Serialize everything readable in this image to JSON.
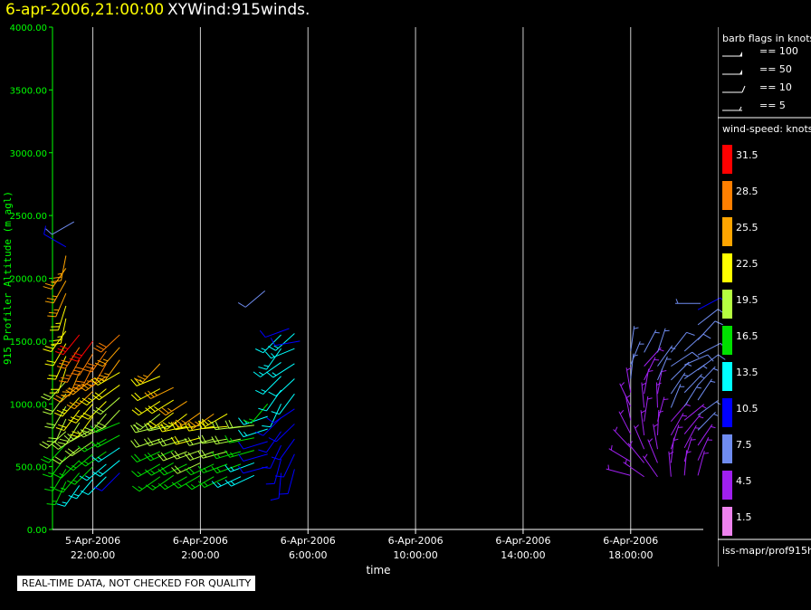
{
  "header": {
    "date_time": "6-apr-2006,21:00:00",
    "product": "XYWind:915winds."
  },
  "legend": {
    "barb_title": "barb flags in knots",
    "barbs": [
      {
        "label": "== 100",
        "type": "flag"
      },
      {
        "label": "== 50",
        "type": "flag"
      },
      {
        "label": "== 10",
        "type": "full"
      },
      {
        "label": "== 5",
        "type": "half"
      }
    ],
    "speed_title": "wind-speed: knots",
    "speed_bins": [
      {
        "label": "31.5",
        "color": "#ff0000"
      },
      {
        "label": "28.5",
        "color": "#ff7f00"
      },
      {
        "label": "25.5",
        "color": "#ffa500"
      },
      {
        "label": "22.5",
        "color": "#ffff00"
      },
      {
        "label": "19.5",
        "color": "#b5ff40"
      },
      {
        "label": "16.5",
        "color": "#00e000"
      },
      {
        "label": "13.5",
        "color": "#00ffff"
      },
      {
        "label": "10.5",
        "color": "#0000ff"
      },
      {
        "label": "7.5",
        "color": "#6f8cf0"
      },
      {
        "label": "4.5",
        "color": "#a020f0"
      },
      {
        "label": "1.5",
        "color": "#ee82ee"
      }
    ],
    "source": "iss-mapr/prof915h"
  },
  "footer_note": "REAL-TIME DATA, NOT CHECKED FOR QUALITY",
  "colors": {
    "axis": "#00ff00",
    "grid": "#cccccc",
    "background": "#000000",
    "title_date": "#ffff00"
  },
  "chart_data": {
    "type": "scatter",
    "marker": "wind-barb",
    "xlabel": "time",
    "ylabel": "915 Profiler Altitude (m agl)",
    "ylim": [
      0,
      4000
    ],
    "yticks": [
      "0.00",
      "500.00",
      "1000.00",
      "1500.00",
      "2000.00",
      "2500.00",
      "3000.00",
      "3500.00",
      "4000.00"
    ],
    "xlim_hours": [
      20.5,
      44.7
    ],
    "xticks": [
      {
        "date": "5-Apr-2006",
        "time": "22:00:00"
      },
      {
        "date": "6-Apr-2006",
        "time": "2:00:00"
      },
      {
        "date": "6-Apr-2006",
        "time": "6:00:00"
      },
      {
        "date": "6-Apr-2006",
        "time": "10:00:00"
      },
      {
        "date": "6-Apr-2006",
        "time": "14:00:00"
      },
      {
        "date": "6-Apr-2006",
        "time": "18:00:00"
      }
    ],
    "xtick_hours": [
      22,
      26,
      30,
      34,
      38,
      42
    ],
    "grid": "vertical",
    "legend_position": "right",
    "speed_units": "knots",
    "profiles": [
      {
        "time": "5-Apr-2006 21:00",
        "hour": 21.0,
        "alt_start": 380,
        "alt_step": 100,
        "alt_count": 19,
        "dir_start": 220,
        "dir_end": 200,
        "speed_start": 16,
        "speed_end": 26
      },
      {
        "time": "5-Apr-2006 21:30",
        "hour": 21.5,
        "alt_start": 350,
        "alt_step": 100,
        "alt_count": 13,
        "dir_start": 230,
        "dir_end": 210,
        "speed_start": 14,
        "speed_end": 30
      },
      {
        "time": "5-Apr-2006 22:00",
        "hour": 22.0,
        "alt_start": 400,
        "alt_step": 100,
        "alt_count": 12,
        "dir_start": 235,
        "dir_end": 215,
        "speed_start": 14,
        "speed_end": 31
      },
      {
        "time": "5-Apr-2006 22:30",
        "hour": 22.5,
        "alt_start": 420,
        "alt_step": 100,
        "alt_count": 11,
        "dir_start": 240,
        "dir_end": 220,
        "speed_start": 12,
        "speed_end": 29
      },
      {
        "time": "5-Apr-2006 23:00",
        "hour": 23.0,
        "alt_start": 450,
        "alt_step": 100,
        "alt_count": 12,
        "dir_start": 240,
        "dir_end": 225,
        "speed_start": 11,
        "speed_end": 28
      },
      {
        "time": "6-Apr-2006 00:30",
        "hour": 24.5,
        "alt_start": 420,
        "alt_step": 100,
        "alt_count": 10,
        "dir_start": 250,
        "dir_end": 235,
        "speed_start": 16,
        "speed_end": 24
      },
      {
        "time": "6-Apr-2006 01:00",
        "hour": 25.0,
        "alt_start": 430,
        "alt_step": 100,
        "alt_count": 8,
        "dir_start": 250,
        "dir_end": 240,
        "speed_start": 15,
        "speed_end": 24
      },
      {
        "time": "6-Apr-2006 01:30",
        "hour": 25.5,
        "alt_start": 420,
        "alt_step": 100,
        "alt_count": 7,
        "dir_start": 255,
        "dir_end": 240,
        "speed_start": 16,
        "speed_end": 25
      },
      {
        "time": "6-Apr-2006 02:00",
        "hour": 26.0,
        "alt_start": 430,
        "alt_step": 100,
        "alt_count": 6,
        "dir_start": 255,
        "dir_end": 245,
        "speed_start": 17,
        "speed_end": 25
      },
      {
        "time": "6-Apr-2006 02:30",
        "hour": 26.5,
        "alt_start": 420,
        "alt_step": 100,
        "alt_count": 6,
        "dir_start": 255,
        "dir_end": 245,
        "speed_start": 16,
        "speed_end": 24
      },
      {
        "time": "6-Apr-2006 03:00",
        "hour": 27.0,
        "alt_start": 420,
        "alt_step": 100,
        "alt_count": 6,
        "dir_start": 260,
        "dir_end": 250,
        "speed_start": 15,
        "speed_end": 23
      },
      {
        "time": "6-Apr-2006 03:30",
        "hour": 27.5,
        "alt_start": 420,
        "alt_step": 100,
        "alt_count": 5,
        "dir_start": 260,
        "dir_end": 250,
        "speed_start": 14,
        "speed_end": 20
      },
      {
        "time": "6-Apr-2006 04:00",
        "hour": 28.0,
        "alt_start": 430,
        "alt_step": 100,
        "alt_count": 5,
        "dir_start": 260,
        "dir_end": 250,
        "speed_start": 13,
        "speed_end": 18
      },
      {
        "time": "6-Apr-2006 04:30",
        "hour": 28.5,
        "alt_start": 500,
        "alt_step": 100,
        "alt_count": 6,
        "dir_start": 270,
        "dir_end": 230,
        "speed_start": 9,
        "speed_end": 15
      },
      {
        "time": "6-Apr-2006 05:00",
        "hour": 29.0,
        "alt_start": 450,
        "alt_step": 110,
        "alt_count": 11,
        "dir_start": 200,
        "dir_end": 230,
        "speed_start": 10,
        "speed_end": 14
      },
      {
        "time": "6-Apr-2006 05:30",
        "hour": 29.5,
        "alt_start": 480,
        "alt_step": 120,
        "alt_count": 10,
        "dir_start": 210,
        "dir_end": 240,
        "speed_start": 11,
        "speed_end": 13
      },
      {
        "time": "6-Apr-2006 18:00",
        "hour": 42.0,
        "alt_start": 430,
        "alt_step": 110,
        "alt_count": 10,
        "dir_start": 300,
        "dir_end": 20,
        "speed_start": 3,
        "speed_end": 7
      },
      {
        "time": "6-Apr-2006 18:30",
        "hour": 42.5,
        "alt_start": 420,
        "alt_step": 110,
        "alt_count": 10,
        "dir_start": 320,
        "dir_end": 40,
        "speed_start": 3,
        "speed_end": 6
      },
      {
        "time": "6-Apr-2006 19:00",
        "hour": 43.0,
        "alt_start": 420,
        "alt_step": 110,
        "alt_count": 10,
        "dir_start": 340,
        "dir_end": 30,
        "speed_start": 3,
        "speed_end": 7
      },
      {
        "time": "6-Apr-2006 19:30",
        "hour": 43.5,
        "alt_start": 420,
        "alt_step": 110,
        "alt_count": 10,
        "dir_start": 10,
        "dir_end": 50,
        "speed_start": 4,
        "speed_end": 8
      },
      {
        "time": "6-Apr-2006 20:00",
        "hour": 44.0,
        "alt_start": 430,
        "alt_step": 110,
        "alt_count": 10,
        "dir_start": 20,
        "dir_end": 60,
        "speed_start": 4,
        "speed_end": 8
      },
      {
        "time": "6-Apr-2006 20:30",
        "hour": 44.5,
        "alt_start": 430,
        "alt_step": 120,
        "alt_count": 12,
        "dir_start": 30,
        "dir_end": 60,
        "speed_start": 5,
        "speed_end": 9
      }
    ],
    "points": [
      {
        "time": "5-Apr-2006 21:00",
        "hour": 21.0,
        "alt": 2250,
        "dir": 300,
        "speed": 9
      },
      {
        "time": "5-Apr-2006 21:30",
        "hour": 21.3,
        "alt": 2450,
        "dir": 240,
        "speed": 8
      },
      {
        "time": "6-Apr-2006 04:30",
        "hour": 28.4,
        "alt": 1900,
        "dir": 230,
        "speed": 8
      },
      {
        "time": "6-Apr-2006 05:00",
        "hour": 29.3,
        "alt": 1600,
        "dir": 250,
        "speed": 9
      },
      {
        "time": "6-Apr-2006 05:30",
        "hour": 29.7,
        "alt": 1500,
        "dir": 260,
        "speed": 10
      },
      {
        "time": "6-Apr-2006 20:30",
        "hour": 44.6,
        "alt": 1800,
        "dir": 270,
        "speed": 7
      }
    ]
  }
}
